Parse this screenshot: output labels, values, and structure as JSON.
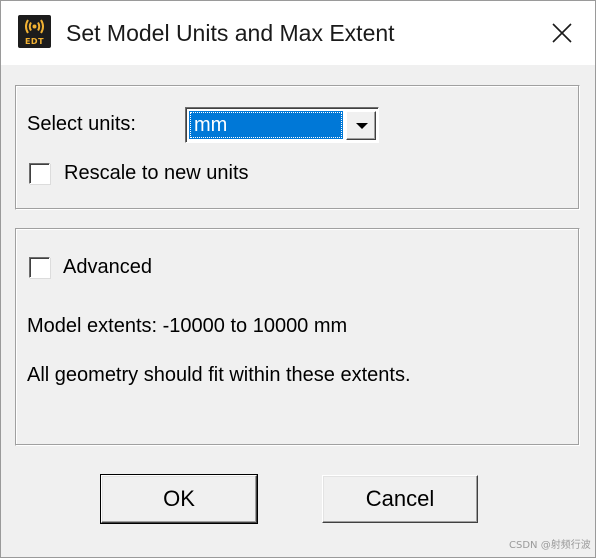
{
  "window": {
    "title": "Set Model Units and Max Extent",
    "icon_name": "edt-app-icon",
    "icon_text": "EDT"
  },
  "units_group": {
    "select_label": "Select units:",
    "select_value": "mm",
    "rescale_label": "Rescale to new units",
    "rescale_checked": false
  },
  "advanced_group": {
    "advanced_label": "Advanced",
    "advanced_checked": false,
    "extents_text": "Model extents: -10000 to 10000 mm",
    "note_text": "All geometry should fit within these extents."
  },
  "buttons": {
    "ok_label": "OK",
    "cancel_label": "Cancel"
  },
  "watermark": "CSDN @射频行波",
  "colors": {
    "selection": "#0078d7",
    "dialog_bg": "#f0f0f0",
    "icon_bg": "#1c1c1c",
    "icon_accent": "#f2b233"
  }
}
